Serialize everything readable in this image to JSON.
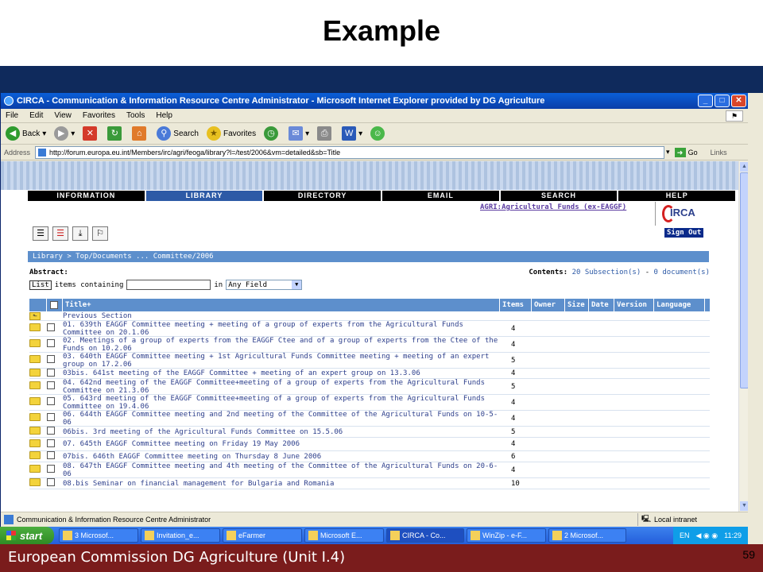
{
  "slide": {
    "title": "Example",
    "footer_text": "European Commission DG Agriculture (Unit I.4)",
    "page_number": "59"
  },
  "window": {
    "title": "CIRCA - Communication & Information Resource Centre Administrator - Microsoft Internet Explorer provided by DG Agriculture",
    "controls": {
      "minimize": "_",
      "maximize": "□",
      "close": "✕"
    }
  },
  "menubar": [
    "File",
    "Edit",
    "View",
    "Favorites",
    "Tools",
    "Help"
  ],
  "toolbar": {
    "back": "Back",
    "search": "Search",
    "favorites": "Favorites"
  },
  "address": {
    "label": "Address",
    "url": "http://forum.europa.eu.int/Members/irc/agri/feoga/library?l=/test/2006&vm=detailed&sb=Title",
    "go": "Go",
    "links": "Links"
  },
  "circa": {
    "nav": [
      "INFORMATION",
      "LIBRARY",
      "DIRECTORY",
      "EMAIL",
      "SEARCH",
      "HELP"
    ],
    "active_nav": "LIBRARY",
    "interest_group": "AGRI:Agricultural Funds (ex-EAGGF)",
    "logo_text": "IRCA",
    "signout": "Sign Out",
    "breadcrumb": "Library > Top/Documents ... Committee/2006",
    "abstract_label": "Abstract:",
    "contents_label": "Contents:",
    "contents_subsections": "20 Subsection(s)",
    "contents_sep": " - ",
    "contents_documents": "0 document(s)",
    "search": {
      "list_button": "List",
      "items_containing": "items containing",
      "in_label": "in",
      "field_select": "Any Field"
    },
    "columns": [
      "Title+",
      "Items",
      "Owner",
      "Size",
      "Date",
      "Version",
      "Language"
    ],
    "previous_section": "Previous Section",
    "rows": [
      {
        "title": "01. 639th EAGGF Committee meeting + meeting of a group of experts from the Agricultural Funds Committee on 20.1.06",
        "items": "4"
      },
      {
        "title": "02. Meetings of a group of experts from the EAGGF Ctee and of a group of experts from the Ctee of the Funds on 10.2.06",
        "items": "4"
      },
      {
        "title": "03. 640th EAGGF Committee meeting + 1st Agricultural Funds Committee meeting + meeting of an expert group on 17.2.06",
        "items": "5"
      },
      {
        "title": "03bis. 641st meeting of the EAGGF Committee + meeting of an expert group on 13.3.06",
        "items": "4"
      },
      {
        "title": "04. 642nd meeting of the EAGGF Committee+meeting of a group of experts from the Agricultural Funds Committee on 21.3.06",
        "items": "5"
      },
      {
        "title": "05. 643rd meeting of the EAGGF Committee+meeting of a group of experts from the Agricultural Funds Committee on 19.4.06",
        "items": "4"
      },
      {
        "title": "06. 644th EAGGF Committee meeting and 2nd meeting of the Committee of the Agricultural Funds on 10-5-06",
        "items": "4"
      },
      {
        "title": "06bis. 3rd meeting of the Agricultural Funds Committee on 15.5.06",
        "items": "5"
      },
      {
        "title": "07. 645th EAGGF Committee meeting on Friday 19 May 2006",
        "items": "4"
      },
      {
        "title": "07bis. 646th EAGGF Committee meeting on Thursday 8 June 2006",
        "items": "6"
      },
      {
        "title": "08. 647th EAGGF Committee meeting and 4th meeting of the Committee of the Agricultural Funds on 20-6-06",
        "items": "4"
      },
      {
        "title": "08.bis Seminar on financial management for Bulgaria and Romania",
        "items": "10"
      }
    ]
  },
  "statusbar": {
    "text": "Communication & Information Resource Centre Administrator",
    "zone": "Local intranet"
  },
  "taskbar": {
    "start": "start",
    "buttons": [
      "3 Microsof...",
      "Invitation_e...",
      "eFarmer",
      "Microsoft E...",
      "CIRCA - Co...",
      "WinZip - e-F...",
      "2 Microsof..."
    ],
    "active_index": 4,
    "lang": "EN",
    "time": "11:29"
  }
}
